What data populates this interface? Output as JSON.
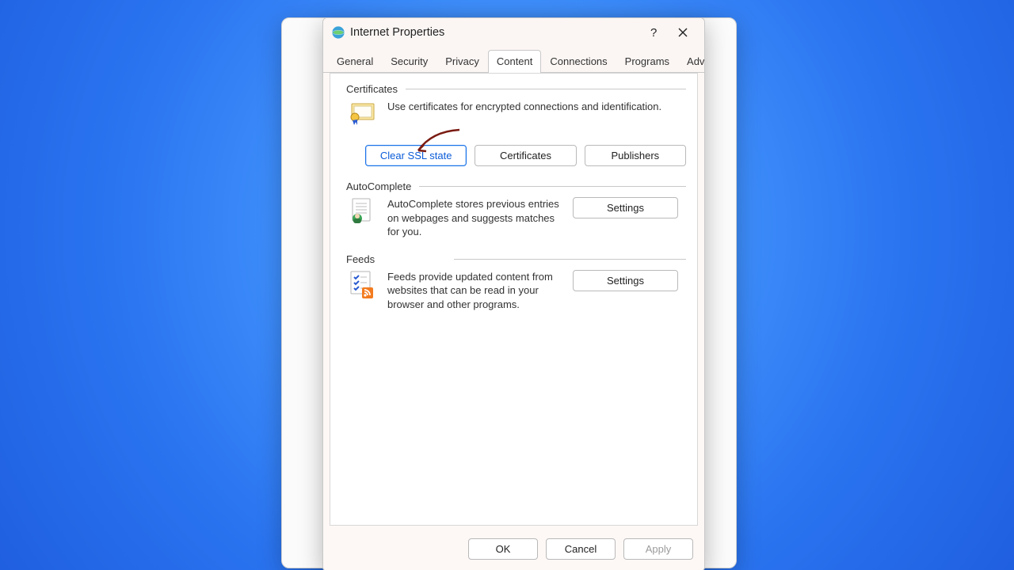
{
  "window": {
    "title": "Internet Properties"
  },
  "tabs": {
    "general": "General",
    "security": "Security",
    "privacy": "Privacy",
    "content": "Content",
    "connections": "Connections",
    "programs": "Programs",
    "advanced": "Advanced"
  },
  "certificates": {
    "heading": "Certificates",
    "description": "Use certificates for encrypted connections and identification.",
    "clear_ssl": "Clear SSL state",
    "certificates_btn": "Certificates",
    "publishers_btn": "Publishers"
  },
  "autocomplete": {
    "heading": "AutoComplete",
    "description": "AutoComplete stores previous entries on webpages and suggests matches for you.",
    "settings_btn": "Settings"
  },
  "feeds": {
    "heading": "Feeds",
    "description": "Feeds provide updated content from websites that can be read in your browser and other programs.",
    "settings_btn": "Settings"
  },
  "footer": {
    "ok": "OK",
    "cancel": "Cancel",
    "apply": "Apply"
  }
}
